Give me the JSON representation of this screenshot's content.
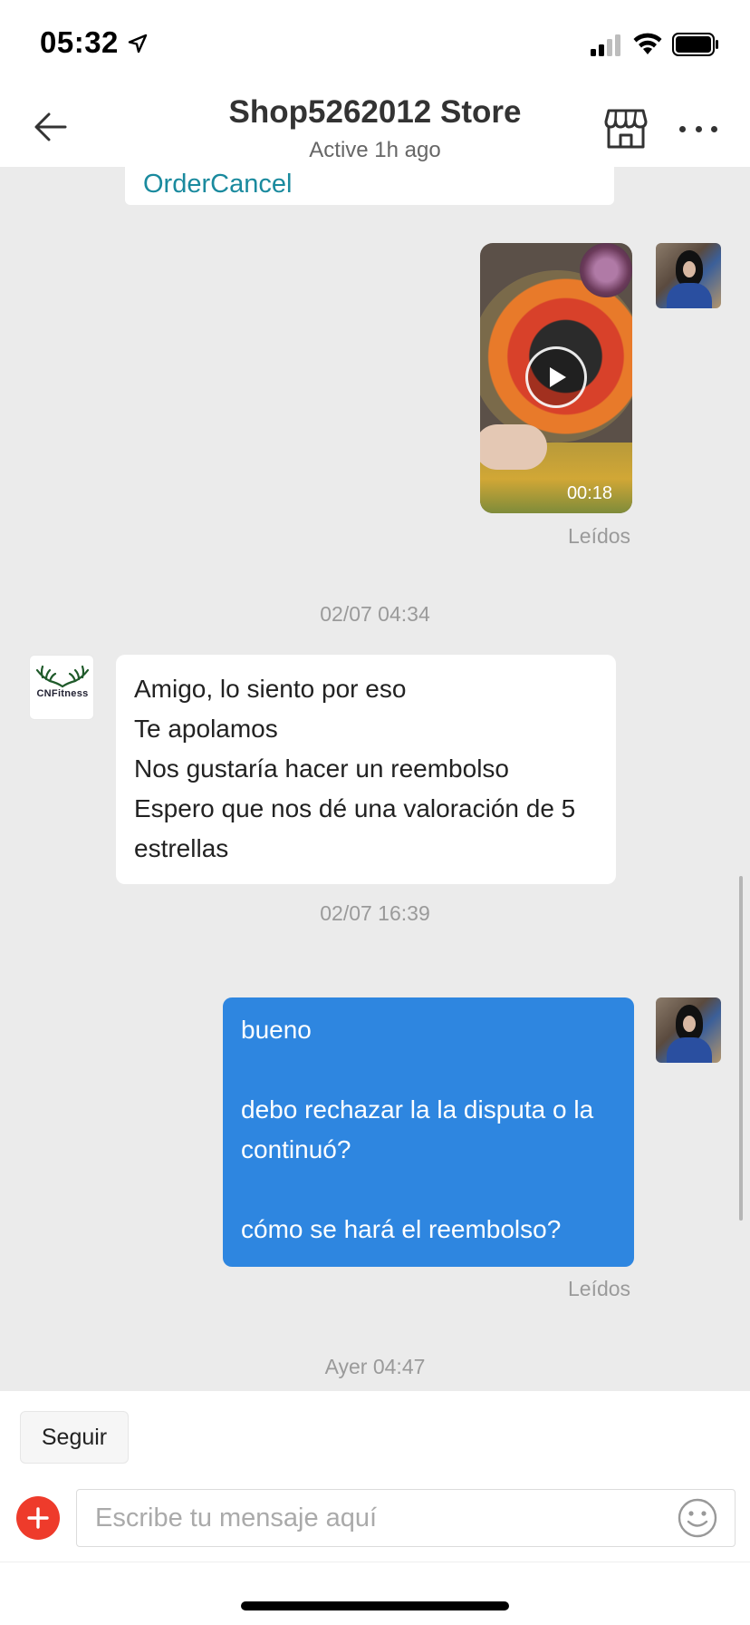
{
  "status_bar": {
    "time": "05:32"
  },
  "header": {
    "title": "Shop5262012 Store",
    "subtitle": "Active 1h ago"
  },
  "chat": {
    "order_card_label": "OrderCancel",
    "video_message": {
      "duration": "00:18",
      "read_label": "Leídos"
    },
    "time_1": "02/07 04:34",
    "shop_avatar_text": "CNFitness",
    "incoming_message": "Amigo, lo siento por eso\nTe apolamos\nNos gustaría hacer un reembolso\nEspero que nos dé una valoración de 5 estrellas",
    "time_2": "02/07 16:39",
    "outgoing_message": "bueno\n\ndebo rechazar la la disputa o la continuó?\n\ncómo se hará el reembolso?",
    "outgoing_read_label": "Leídos",
    "time_3": "Ayer 04:47"
  },
  "bottom": {
    "follow_label": "Seguir",
    "input_placeholder": "Escribe tu mensaje aquí"
  },
  "colors": {
    "accent_blue": "#2e86e0",
    "order_link": "#1a8a9e",
    "plus_red": "#ee3b2b"
  }
}
